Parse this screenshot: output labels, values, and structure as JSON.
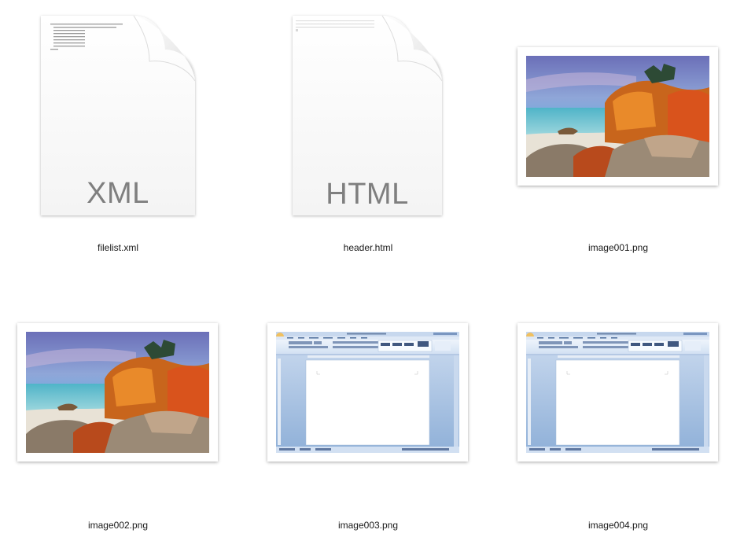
{
  "files": [
    {
      "name": "filelist.xml",
      "kind": "XML",
      "icon": "xml-document-icon"
    },
    {
      "name": "header.html",
      "kind": "HTML",
      "icon": "html-document-icon"
    },
    {
      "name": "image001.png",
      "icon": "landscape-photo-thumbnail"
    },
    {
      "name": "image002.png",
      "icon": "landscape-photo-thumbnail"
    },
    {
      "name": "image003.png",
      "icon": "word-window-thumbnail"
    },
    {
      "name": "image004.png",
      "icon": "word-window-thumbnail"
    }
  ]
}
